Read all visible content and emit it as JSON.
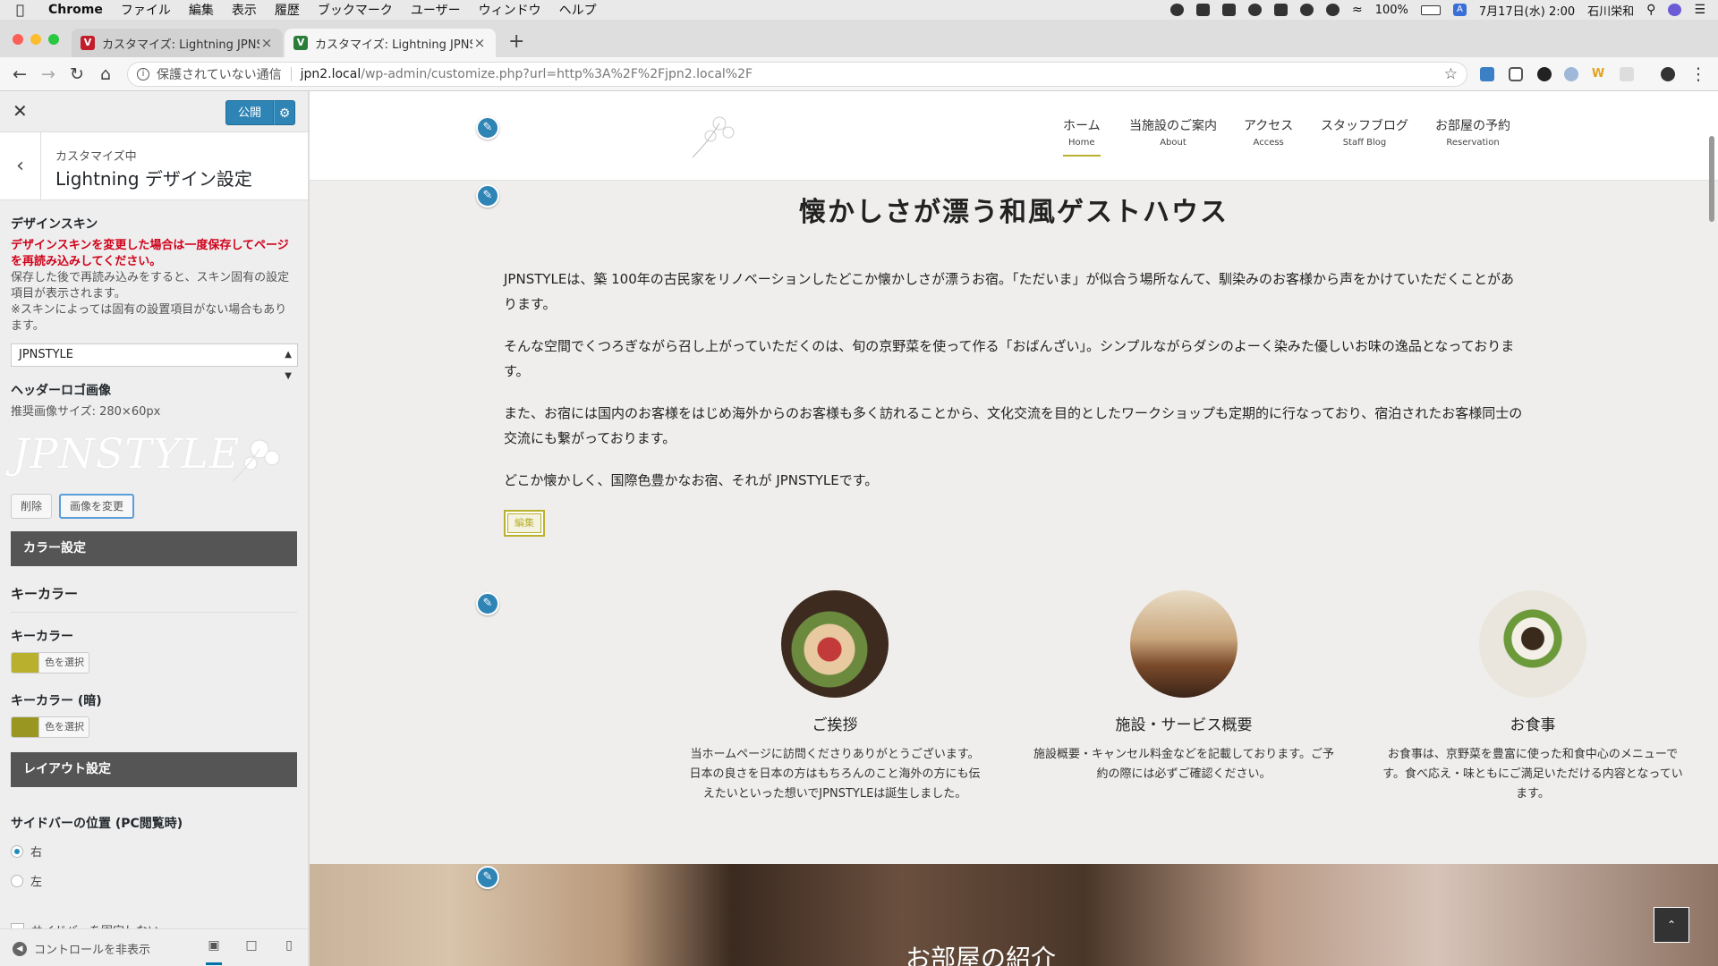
{
  "menubar": {
    "app": "Chrome",
    "items": [
      "ファイル",
      "編集",
      "表示",
      "履歴",
      "ブックマーク",
      "ユーザー",
      "ウィンドウ",
      "ヘルプ"
    ],
    "battery": "100%",
    "datetime": "7月17日(水) 2:00",
    "user": "石川栄和"
  },
  "tabs": [
    {
      "title": "カスタマイズ: Lightning JPNSTY",
      "favicon": "V",
      "color": "#c21d2a"
    },
    {
      "title": "カスタマイズ: Lightning JPNSTY",
      "favicon": "V",
      "color": "#2b7d3a"
    }
  ],
  "address": {
    "security": "保護されていない通信",
    "host": "jpn2.local",
    "path": "/wp-admin/customize.php?url=http%3A%2F%2Fjpn2.local%2F"
  },
  "customizer": {
    "publish": "公開",
    "section_small": "カスタマイズ中",
    "section_title": "Lightning デザイン設定",
    "skin_label": "デザインスキン",
    "skin_warning": "デザインスキンを変更した場合は一度保存してページを再読み込みしてください。",
    "skin_desc1": "保存した後で再読み込みをすると、スキン固有の設定項目が表示されます。",
    "skin_desc2": "※スキンによっては固有の設置項目がない場合もあります。",
    "skin_value": "JPNSTYLE",
    "logo_label": "ヘッダーロゴ画像",
    "logo_size": "推奨画像サイズ: 280×60px",
    "logo_text": "JPNSTYLE",
    "delete_btn": "削除",
    "change_btn": "画像を変更",
    "color_section": "カラー設定",
    "keycolor_head": "キーカラー",
    "keycolor_label": "キーカラー",
    "keycolor_value": "#b9b12d",
    "keycolor_dark_label": "キーカラー (暗)",
    "keycolor_dark_value": "#9a9622",
    "choose_color": "色を選択",
    "layout_section": "レイアウト設定",
    "sidebar_pos_label": "サイドバーの位置 (PC閲覧時)",
    "radio_right": "右",
    "radio_left": "左",
    "sidebar_fix": "サイドバーを固定しない",
    "hide_controls": "コントロールを非表示"
  },
  "site": {
    "nav": [
      {
        "jp": "ホーム",
        "en": "Home"
      },
      {
        "jp": "当施設のご案内",
        "en": "About"
      },
      {
        "jp": "アクセス",
        "en": "Access"
      },
      {
        "jp": "スタッフブログ",
        "en": "Staff Blog"
      },
      {
        "jp": "お部屋の予約",
        "en": "Reservation"
      }
    ],
    "title": "懐かしさが漂う和風ゲストハウス",
    "paragraphs": [
      "JPNSTYLEは、築 100年の古民家をリノベーションしたどこか懐かしさが漂うお宿。「ただいま」が似合う場所なんて、馴染みのお客様から声をかけていただくことがあります。",
      "そんな空間でくつろぎながら召し上がっていただくのは、旬の京野菜を使って作る「おばんざい」。シンプルながらダシのよーく染みた優しいお味の逸品となっております。",
      "また、お宿には国内のお客様をはじめ海外からのお客様も多く訪れることから、文化交流を目的としたワークショップも定期的に行なっており、宿泊されたお客様同士の交流にも繋がっております。",
      "どこか懐かしく、国際色豊かなお宿、それが JPNSTYLEです。"
    ],
    "edit": "編集",
    "features": [
      {
        "title": "ご挨拶",
        "desc": "当ホームページに訪問くださりありがとうございます。日本の良さを日本の方はもちろんのこと海外の方にも伝えたいといった想いでJPNSTYLEは誕生しました。"
      },
      {
        "title": "施設・サービス概要",
        "desc": "施設概要・キャンセル料金などを記載しております。ご予約の際には必ずご確認ください。"
      },
      {
        "title": "お食事",
        "desc": "お食事は、京野菜を豊富に使った和食中心のメニューです。食べ応え・味ともにご満足いただける内容となっています。"
      }
    ],
    "banner_title": "お部屋の紹介"
  }
}
